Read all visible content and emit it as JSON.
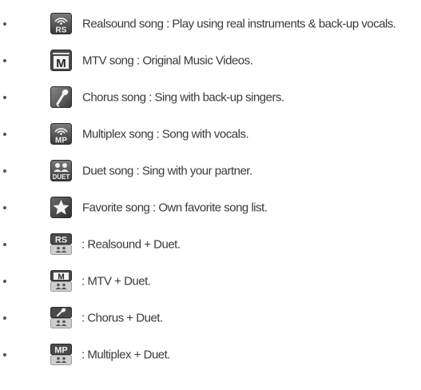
{
  "items": [
    {
      "icon": "realsound-icon",
      "text": "Realsound song : Play using real instruments & back-up vocals."
    },
    {
      "icon": "mtv-icon",
      "text": "MTV song : Original Music Videos."
    },
    {
      "icon": "chorus-microphone-icon",
      "text": "Chorus song : Sing with back-up singers."
    },
    {
      "icon": "multiplex-icon",
      "text": "Multiplex song : Song with vocals."
    },
    {
      "icon": "duet-icon",
      "text": "Duet song : Sing with your partner."
    },
    {
      "icon": "favorite-star-icon",
      "text": "Favorite song : Own favorite song list."
    },
    {
      "icon": "realsound-duet-icon",
      "text": ": Realsound + Duet."
    },
    {
      "icon": "mtv-duet-icon",
      "text": ": MTV + Duet."
    },
    {
      "icon": "chorus-duet-icon",
      "text": ": Chorus + Duet."
    },
    {
      "icon": "multiplex-duet-icon",
      "text": ": Multiplex + Duet."
    }
  ],
  "icon_labels": {
    "rs": "RS",
    "m": "M",
    "mp": "MP",
    "duet": "DUET"
  },
  "colors": {
    "icon_dark": "#4a4a4a",
    "icon_light": "#cfcfcf",
    "text": "#3a3a3a"
  }
}
